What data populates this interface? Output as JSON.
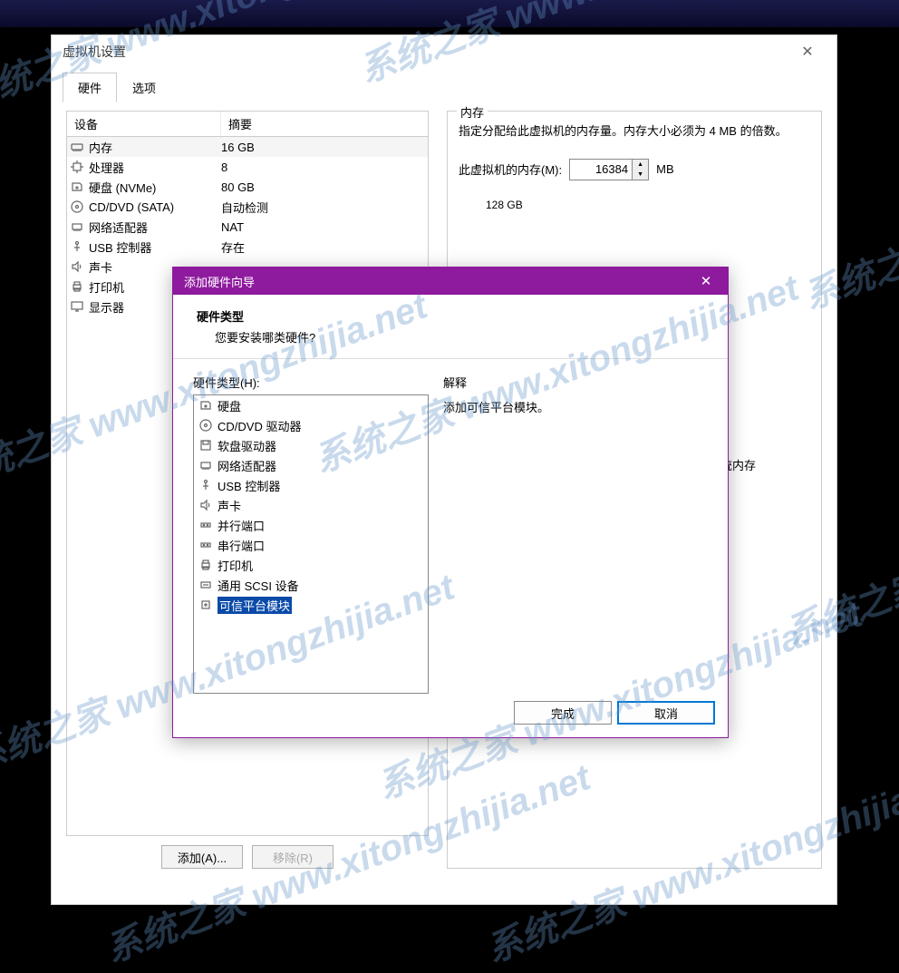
{
  "watermark_text": "系统之家 www.xitongzhijia.net",
  "settings": {
    "title": "虚拟机设置",
    "tabs": {
      "hardware": "硬件",
      "options": "选项"
    },
    "device_header": {
      "device": "设备",
      "summary": "摘要"
    },
    "devices": [
      {
        "icon": "memory",
        "label": "内存",
        "summary": "16 GB",
        "selected": true
      },
      {
        "icon": "cpu",
        "label": "处理器",
        "summary": "8"
      },
      {
        "icon": "disk",
        "label": "硬盘 (NVMe)",
        "summary": "80 GB"
      },
      {
        "icon": "disc",
        "label": "CD/DVD (SATA)",
        "summary": "自动检测"
      },
      {
        "icon": "nic",
        "label": "网络适配器",
        "summary": "NAT"
      },
      {
        "icon": "usb",
        "label": "USB 控制器",
        "summary": "存在"
      },
      {
        "icon": "sound",
        "label": "声卡",
        "summary": ""
      },
      {
        "icon": "printer",
        "label": "打印机",
        "summary": ""
      },
      {
        "icon": "display",
        "label": "显示器",
        "summary": ""
      }
    ],
    "add_btn": "添加(A)...",
    "remove_btn": "移除(R)",
    "memory": {
      "legend": "内存",
      "desc": "指定分配给此虚拟机的内存量。内存大小必须为 4 MB 的倍数。",
      "label": "此虚拟机的内存(M):",
      "value": "16384",
      "unit": "MB",
      "scale_top": "128 GB",
      "os_note": "操作系统内存"
    }
  },
  "wizard": {
    "title": "添加硬件向导",
    "header_title": "硬件类型",
    "header_sub": "您要安装哪类硬件?",
    "list_label": "硬件类型(H):",
    "explain_label": "解释",
    "explain_text": "添加可信平台模块。",
    "items": [
      {
        "icon": "disk",
        "label": "硬盘"
      },
      {
        "icon": "disc",
        "label": "CD/DVD 驱动器"
      },
      {
        "icon": "floppy",
        "label": "软盘驱动器"
      },
      {
        "icon": "nic",
        "label": "网络适配器"
      },
      {
        "icon": "usb",
        "label": "USB 控制器"
      },
      {
        "icon": "sound",
        "label": "声卡"
      },
      {
        "icon": "port",
        "label": "并行端口"
      },
      {
        "icon": "port",
        "label": "串行端口"
      },
      {
        "icon": "printer",
        "label": "打印机"
      },
      {
        "icon": "scsi",
        "label": "通用 SCSI 设备"
      },
      {
        "icon": "tpm",
        "label": "可信平台模块",
        "selected": true
      }
    ],
    "finish_btn": "完成",
    "cancel_btn": "取消"
  }
}
